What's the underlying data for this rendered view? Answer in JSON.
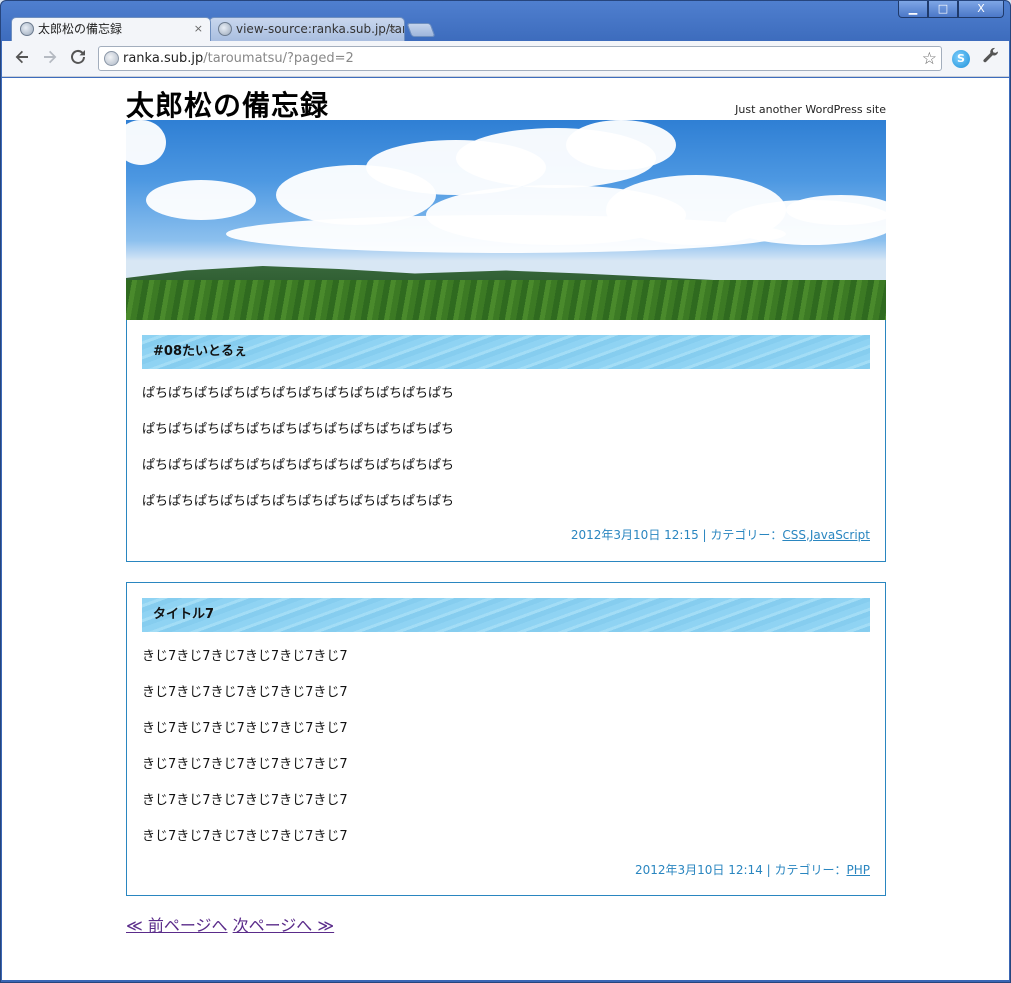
{
  "browser": {
    "tabs": [
      {
        "title": "太郎松の備忘録",
        "close": "×",
        "active": true
      },
      {
        "title": "view-source:ranka.sub.jp/tar",
        "close": "×",
        "active": false
      }
    ],
    "window_controls": {
      "minimize": "▁",
      "maximize": "□",
      "close": "X"
    },
    "address": {
      "domain": "ranka.sub.jp",
      "path": "/taroumatsu/?paged=2"
    },
    "icons": [
      "back-icon",
      "forward-icon",
      "reload-icon",
      "globe-icon",
      "star-icon",
      "skype-icon",
      "wrench-icon"
    ]
  },
  "site": {
    "title": "太郎松の備忘録",
    "tagline": "Just another WordPress site"
  },
  "posts": [
    {
      "title": "#08たいとるぇ",
      "lines": [
        "ぱちぱちぱちぱちぱちぱちぱちぱちぱちぱちぱちぱち",
        "ぱちぱちぱちぱちぱちぱちぱちぱちぱちぱちぱちぱち",
        "ぱちぱちぱちぱちぱちぱちぱちぱちぱちぱちぱちぱち",
        "ぱちぱちぱちぱちぱちぱちぱちぱちぱちぱちぱちぱち"
      ],
      "meta_text": "2012年3月10日 12:15 | カテゴリー：",
      "categories": [
        "CSS",
        "JavaScript"
      ]
    },
    {
      "title": "タイトル7",
      "lines": [
        "きじ7きじ7きじ7きじ7きじ7きじ7",
        "きじ7きじ7きじ7きじ7きじ7きじ7",
        "きじ7きじ7きじ7きじ7きじ7きじ7",
        "きじ7きじ7きじ7きじ7きじ7きじ7",
        "きじ7きじ7きじ7きじ7きじ7きじ7",
        "きじ7きじ7きじ7きじ7きじ7きじ7"
      ],
      "meta_text": "2012年3月10日 12:14 | カテゴリー：",
      "categories": [
        "PHP"
      ]
    }
  ],
  "pager": {
    "prev": "≪ 前ページへ",
    "next": "次ページへ ≫"
  },
  "colors": {
    "accent": "#2a86c0",
    "title_bar": "#8fd3f3",
    "visited_link": "#5a2b8a"
  }
}
